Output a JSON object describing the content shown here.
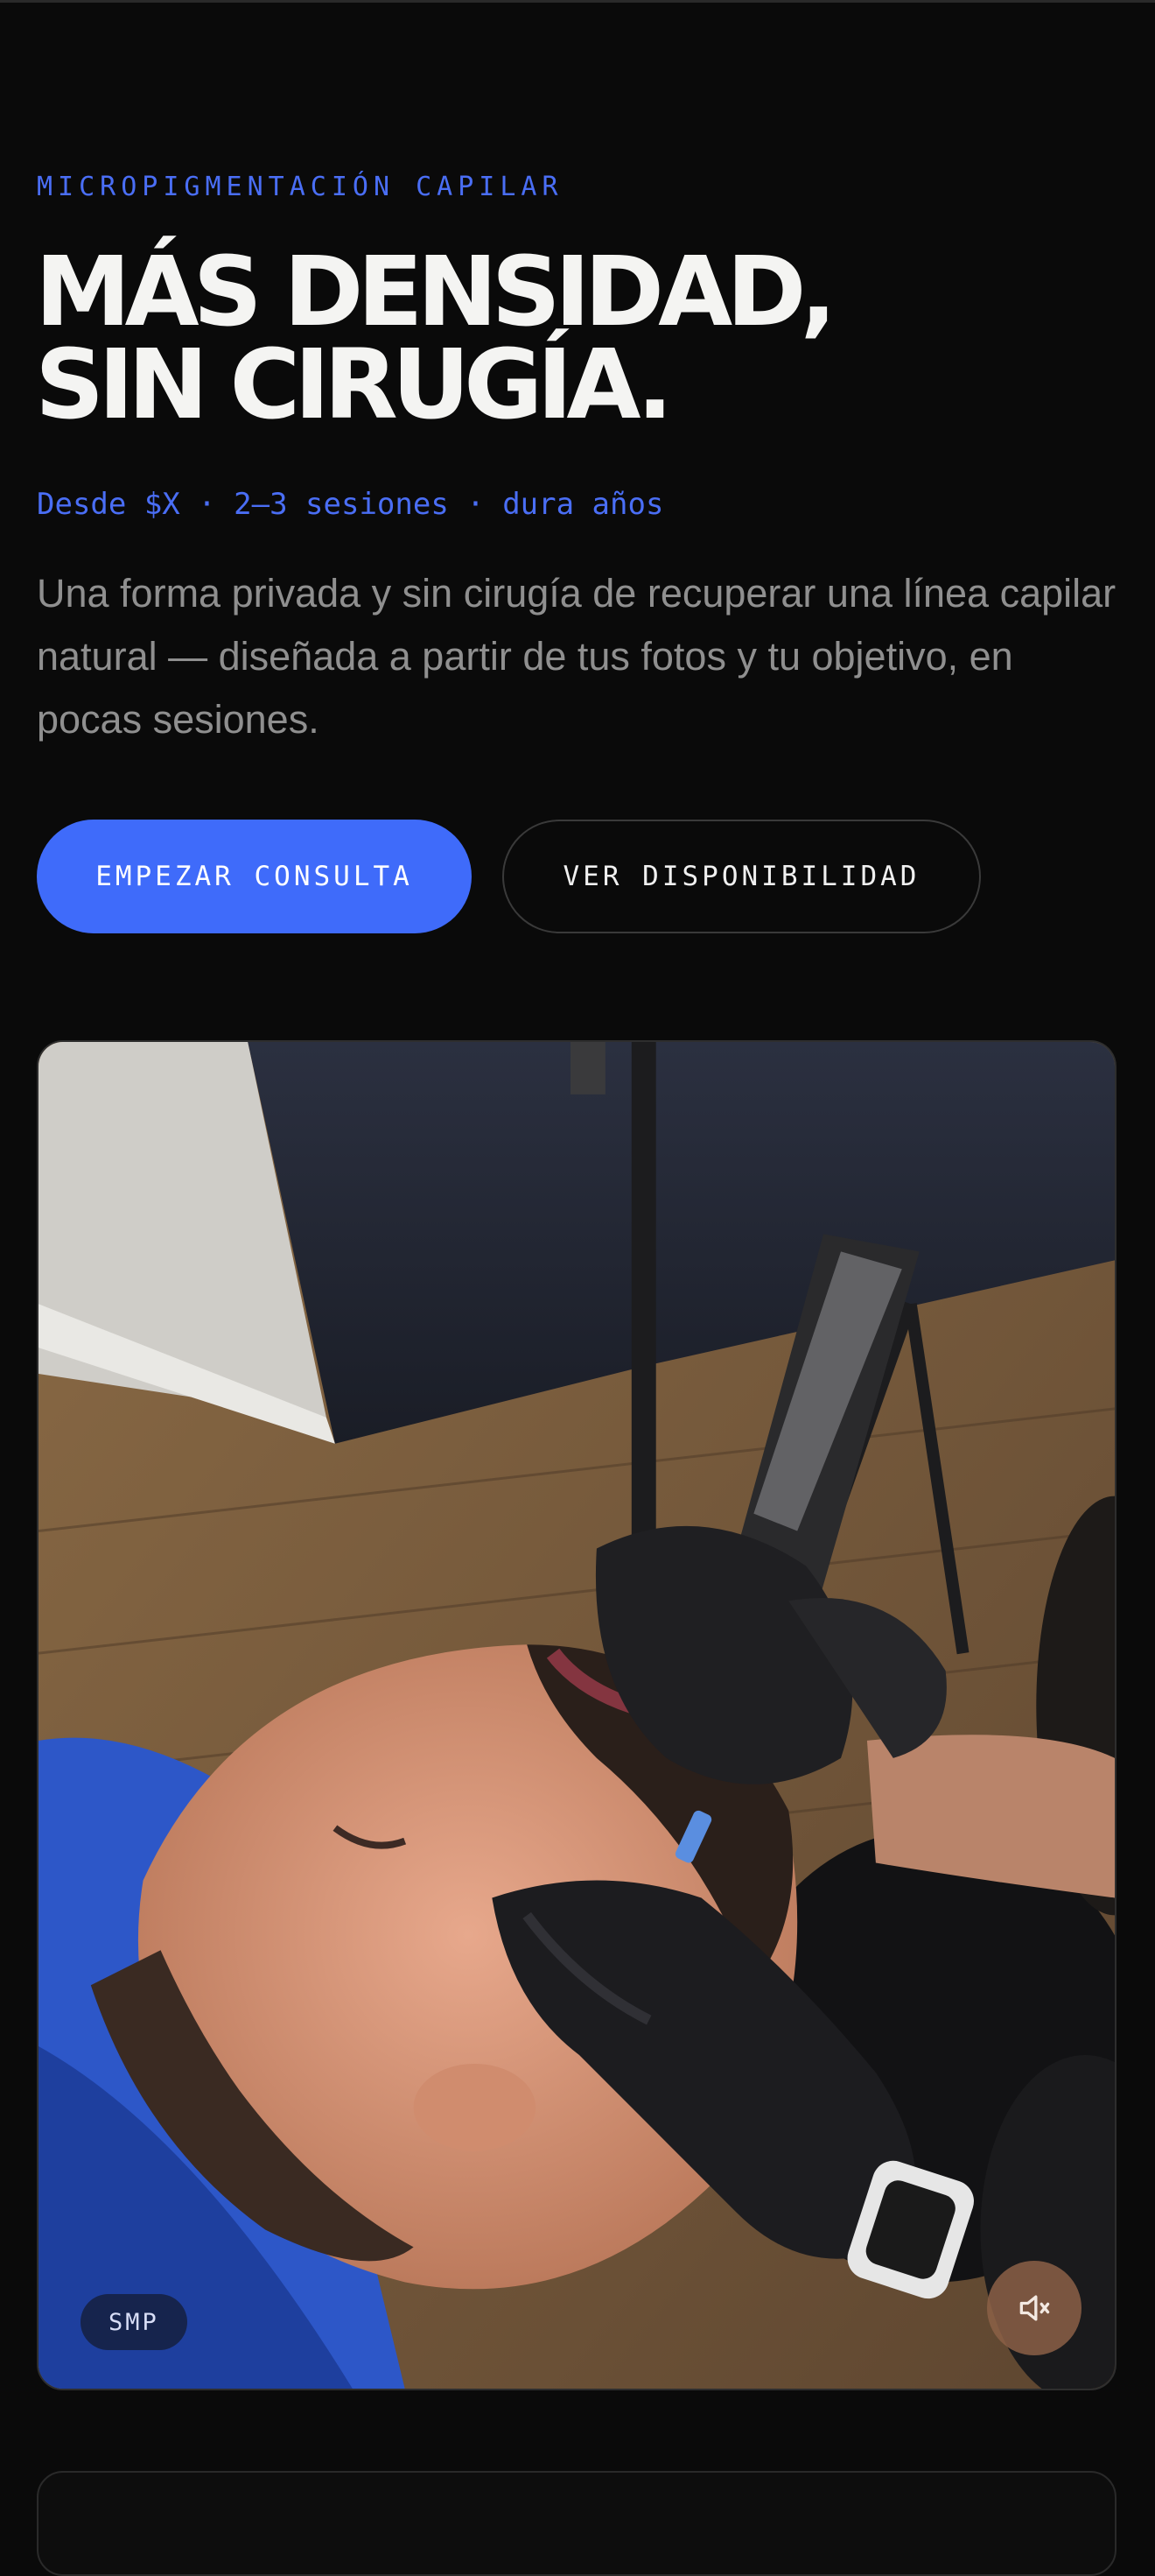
{
  "hero": {
    "eyebrow": "MICROPIGMENTACIÓN CAPILAR",
    "title_line1": "MÁS DENSIDAD,",
    "title_line2": "SIN CIRUGÍA.",
    "meta": "Desde $X · 2–3 sesiones · dura años",
    "description": "Una forma privada y sin cirugía de recuperar una línea capilar natural — diseñada a partir de tus fotos y tu objetivo, en pocas sesiones."
  },
  "actions": {
    "primary_label": "EMPEZAR CONSULTA",
    "secondary_label": "VER DISPONIBILIDAD"
  },
  "media": {
    "badge": "SMP",
    "mute_icon": "speaker-muted-icon",
    "state": "muted"
  },
  "colors": {
    "background": "#0a0a0a",
    "accent": "#3f6bfa",
    "accent_text": "#4a6ef5",
    "heading": "#f4f4f2",
    "body_text": "#8f8f8f"
  }
}
